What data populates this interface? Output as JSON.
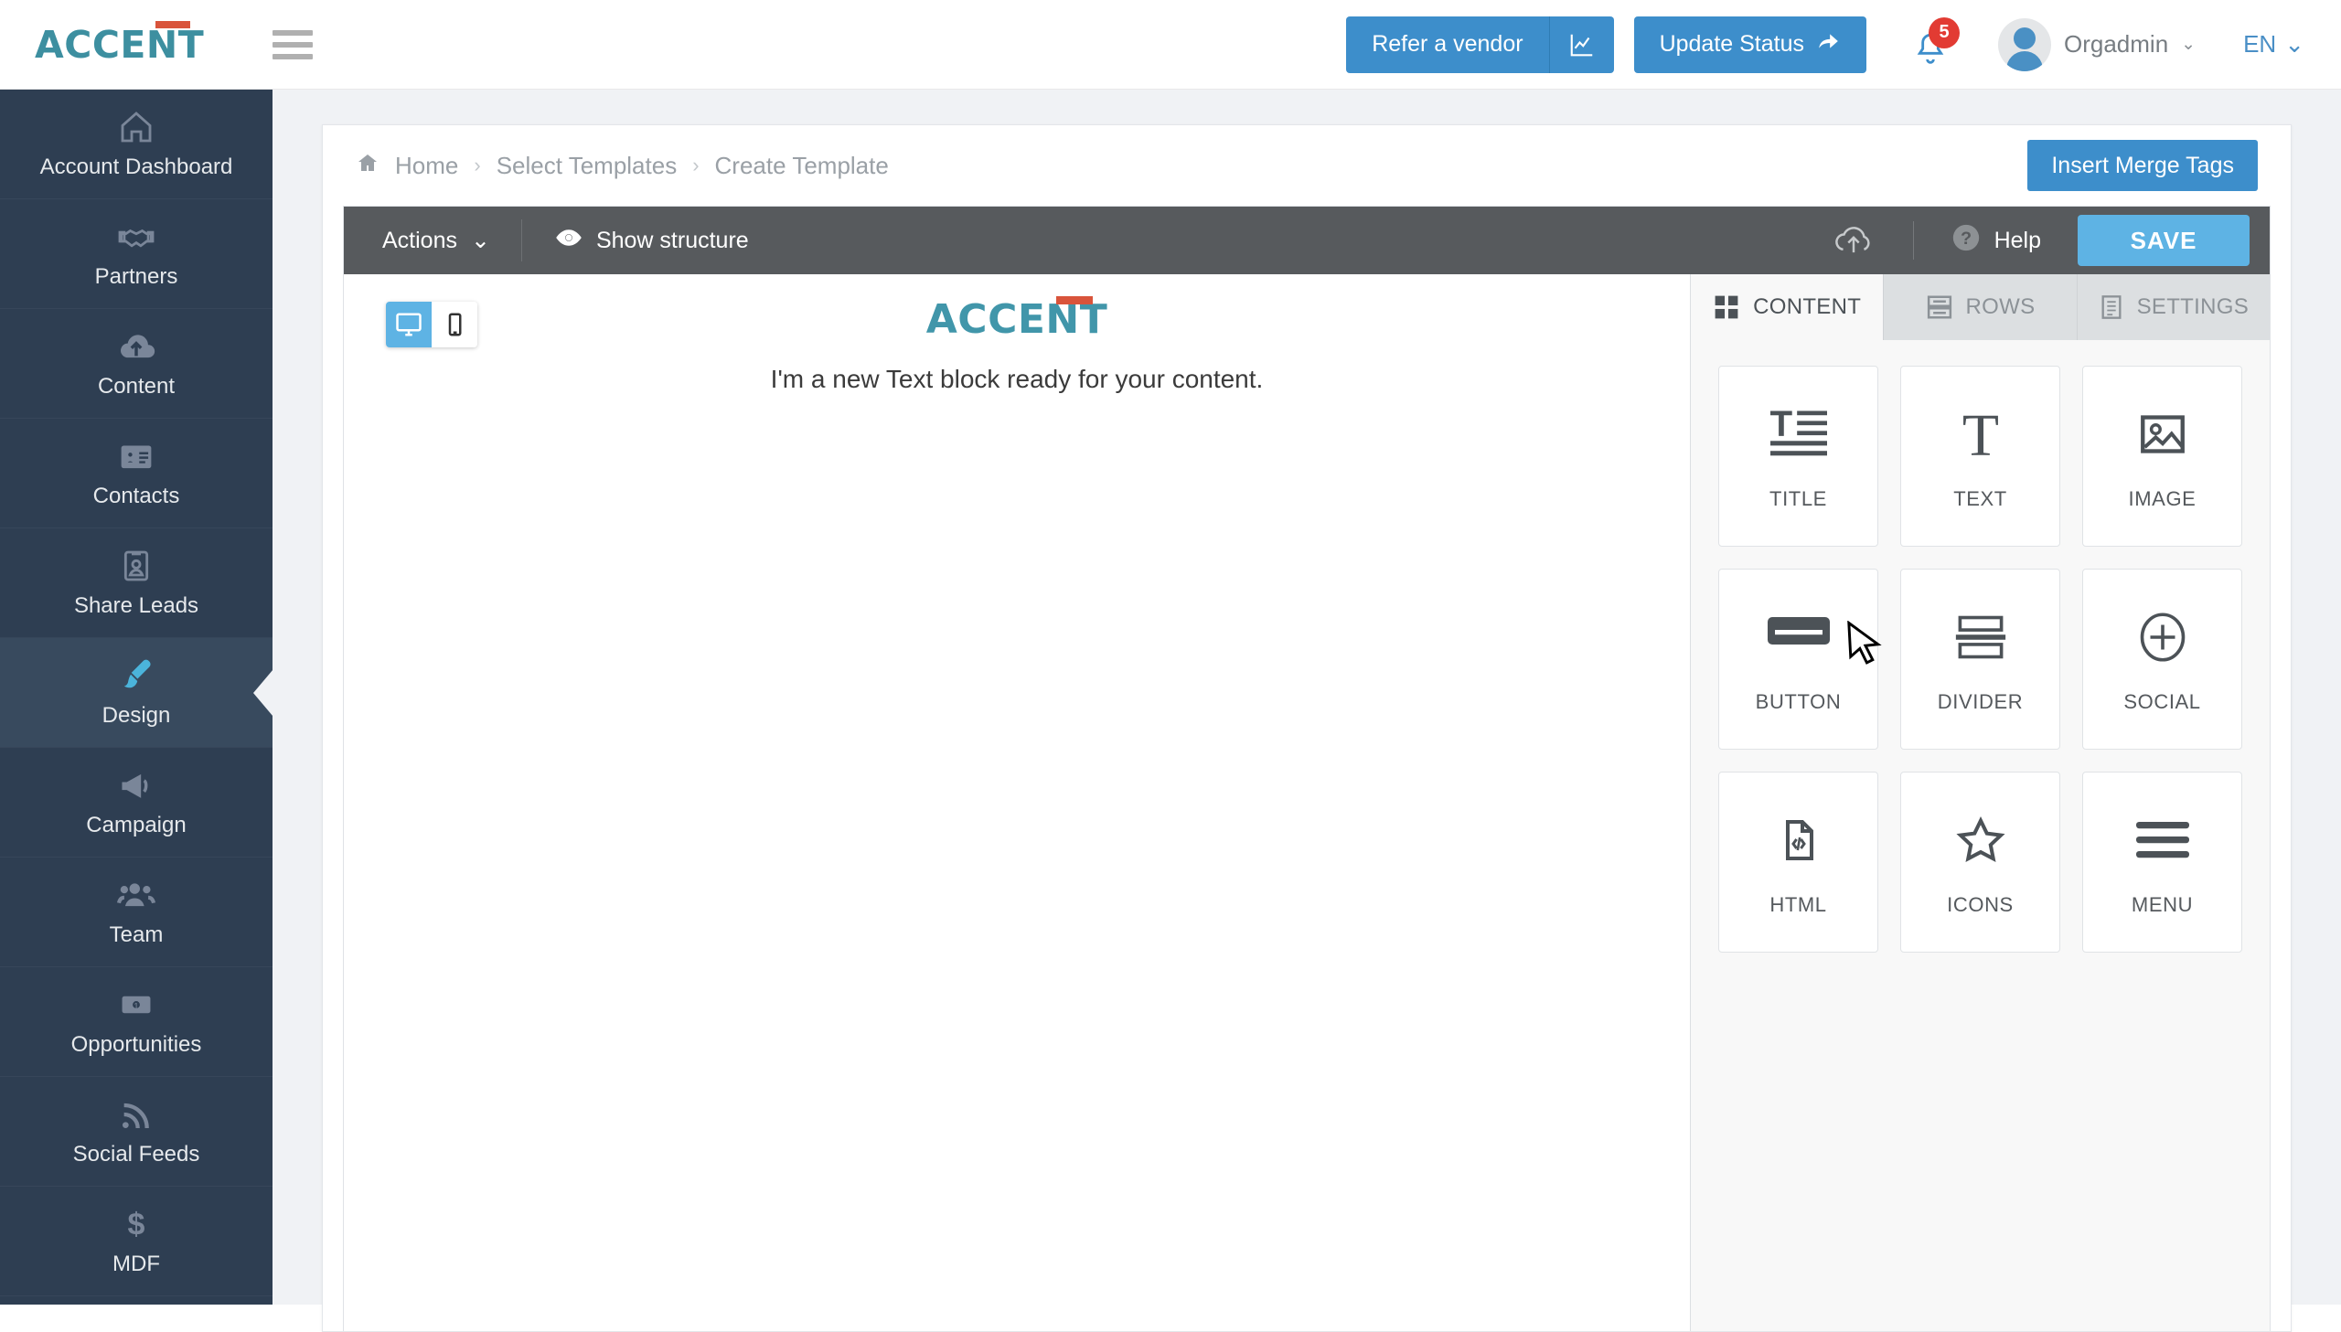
{
  "brand": {
    "name": "ACCENT",
    "accent_color": "#d9543b",
    "text_color": "#3d8fa0"
  },
  "header": {
    "menu_icon": "hamburger-icon",
    "refer_label": "Refer a vendor",
    "chart_icon": "line-chart-icon",
    "update_label": "Update Status",
    "update_icon": "share-arrow-icon",
    "bell_icon": "bell-icon",
    "notification_count": "5",
    "user_name": "Orgadmin",
    "user_caret": "⌄",
    "language": "EN",
    "language_caret": "⌄",
    "accent_blue": "#3d8ecb"
  },
  "sidebar": {
    "items": [
      {
        "label": "Account Dashboard",
        "icon": "home-icon",
        "active": false
      },
      {
        "label": "Partners",
        "icon": "handshake-icon",
        "active": false
      },
      {
        "label": "Content",
        "icon": "cloud-upload-icon",
        "active": false
      },
      {
        "label": "Contacts",
        "icon": "id-card-icon",
        "active": false
      },
      {
        "label": "Share Leads",
        "icon": "user-card-icon",
        "active": false
      },
      {
        "label": "Design",
        "icon": "paint-brush-icon",
        "active": true
      },
      {
        "label": "Campaign",
        "icon": "megaphone-icon",
        "active": false
      },
      {
        "label": "Team",
        "icon": "users-icon",
        "active": false
      },
      {
        "label": "Opportunities",
        "icon": "money-bill-icon",
        "active": false
      },
      {
        "label": "Social Feeds",
        "icon": "rss-icon",
        "active": false
      },
      {
        "label": "MDF",
        "icon": "dollar-sign-icon",
        "active": false
      }
    ]
  },
  "breadcrumb": {
    "home_icon": "home-icon",
    "items": [
      "Home",
      "Select Templates",
      "Create Template"
    ],
    "separator": "›"
  },
  "page_actions": {
    "merge_tags_label": "Insert Merge Tags"
  },
  "editor_toolbar": {
    "actions_label": "Actions",
    "actions_caret": "⌄",
    "show_structure_label": "Show structure",
    "show_structure_icon": "eye-icon",
    "upload_icon": "cloud-upload-icon",
    "help_label": "Help",
    "help_icon": "question-circle-icon",
    "save_label": "SAVE"
  },
  "canvas": {
    "device_desktop_icon": "desktop-icon",
    "device_mobile_icon": "mobile-icon",
    "active_device": "desktop",
    "email_logo": "ACCENT",
    "email_text": "I'm a new Text block ready for your content."
  },
  "right_panel": {
    "tabs": [
      {
        "label": "CONTENT",
        "icon": "grid-icon",
        "active": true
      },
      {
        "label": "ROWS",
        "icon": "rows-icon",
        "active": false
      },
      {
        "label": "SETTINGS",
        "icon": "document-lines-icon",
        "active": false
      }
    ],
    "blocks": [
      {
        "label": "TITLE",
        "icon": "title-icon"
      },
      {
        "label": "TEXT",
        "icon": "text-t-icon"
      },
      {
        "label": "IMAGE",
        "icon": "image-icon"
      },
      {
        "label": "BUTTON",
        "icon": "button-icon"
      },
      {
        "label": "DIVIDER",
        "icon": "divider-icon"
      },
      {
        "label": "SOCIAL",
        "icon": "plus-circle-icon"
      },
      {
        "label": "HTML",
        "icon": "code-file-icon"
      },
      {
        "label": "ICONS",
        "icon": "star-icon"
      },
      {
        "label": "MENU",
        "icon": "menu-bars-icon"
      }
    ]
  }
}
